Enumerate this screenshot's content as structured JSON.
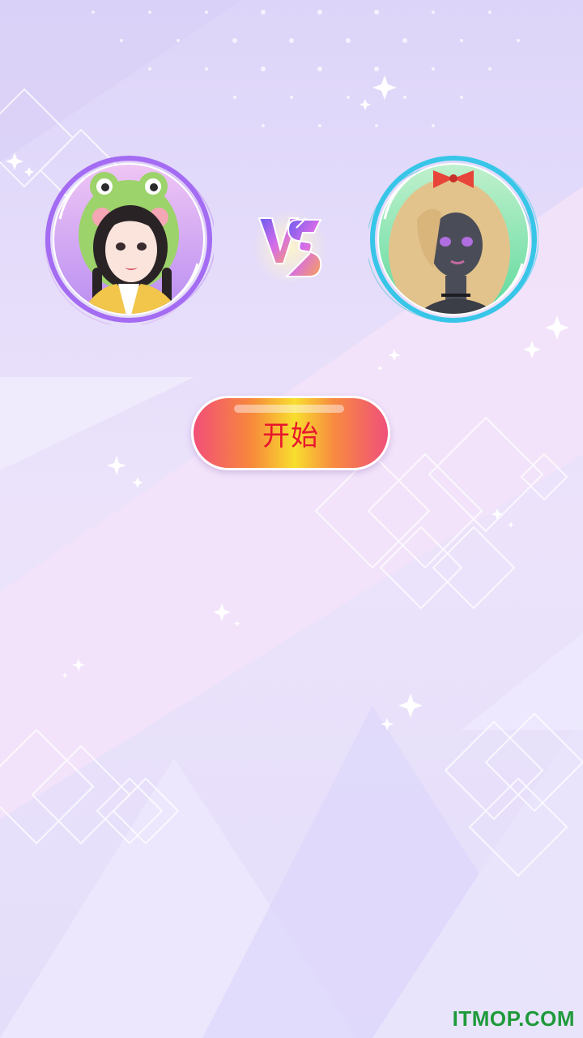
{
  "game": {
    "start_label": "开始",
    "vs_label": "VS"
  },
  "players": [
    {
      "name": "frog-hood-girl",
      "ring_color": "#a36cf2",
      "portrait_bg": "#cfa8f5"
    },
    {
      "name": "blonde-bow-girl",
      "ring_color": "#38c6e8",
      "portrait_bg": "#7ee3a8"
    }
  ],
  "watermark": "ITMOP.COM",
  "colors": {
    "background": "#e6e0fa",
    "start_text": "#e8162e",
    "watermark": "#1f9a3a"
  }
}
